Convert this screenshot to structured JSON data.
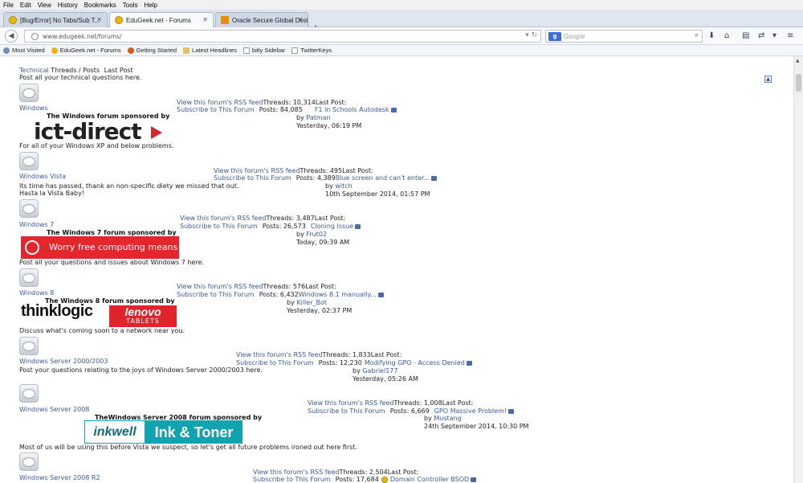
{
  "menu": [
    "File",
    "Edit",
    "View",
    "History",
    "Bookmarks",
    "Tools",
    "Help"
  ],
  "tabs": [
    {
      "label": "[Bug/Error] No Tabs/Sub T...",
      "icon": "edugeek-icon"
    },
    {
      "label": "EduGeek.net - Forums",
      "icon": "edugeek-icon"
    },
    {
      "label": "Oracle Secure Global Deskt...",
      "icon": "oracle-icon"
    }
  ],
  "address": {
    "url": "www.edugeek.net/forums/",
    "search_placeholder": "Google"
  },
  "bookmarks": [
    "Most Visited",
    "EduGeek.net - Forums",
    "Getting Started",
    "Latest Headlines",
    "bitly Sidebar",
    "TwitterKeys"
  ],
  "header": {
    "category": "Technical",
    "columns": "Threads / Posts",
    "last_post": "Last Post",
    "description": "Post all your technical questions here."
  },
  "rss_label": "View this forum's RSS feed",
  "subscribe_label": "Subscribe to This Forum",
  "by_label": "by",
  "forums": [
    {
      "name": "Windows",
      "threads": "Threads: 10,314",
      "posts": "Posts: 84,085",
      "last_post_label": "Last Post:",
      "last_title": "F1 in Schools Autodesk",
      "last_user": "Patman",
      "last_time": "Yesterday, 06:19 PM",
      "sponsor": "The Windows forum sponsored by",
      "sponsor_logo": "ict-direct",
      "desc": "For all of your Windows XP and below problems."
    },
    {
      "name": "Windows Vista",
      "threads": "Threads: 495",
      "posts": "Posts: 4,389",
      "last_post_label": "Last Post:",
      "last_title": "Blue screen and can't enter...",
      "last_user": "witch",
      "last_time": "10th September 2014, 01:57 PM",
      "desc": "Its time has passed, thank an non-specific diety we missed that out.",
      "desc2": "Hasta la Vista Baby!"
    },
    {
      "name": "Windows 7",
      "threads": "Threads: 3,487",
      "posts": "Posts: 26,573",
      "last_post_label": "Last Post:",
      "last_title": "Cloning Issue",
      "last_user": "Frut02",
      "last_time": "Today, 09:39 AM",
      "sponsor": "The Windows 7 forum sponsored by",
      "banner_text": "Worry free computing means",
      "banner_logo": "novatech",
      "desc": "Post all your questions and issues about Windows 7 here."
    },
    {
      "name": "Windows 8",
      "threads": "Threads: 576",
      "posts": "Posts: 6,432",
      "last_post_label": "Last Post:",
      "last_title": "Windows 8.1 manually...",
      "last_user": "Killer_Bot",
      "last_time": "Yesterday, 02:37 PM",
      "sponsor": "The Windows 8 forum sponsored by",
      "logo_left": "thinklogic",
      "logo_right": "lenovo",
      "logo_right_sub": "TABLETS",
      "desc": "Discuss what's coming soon to a network near you."
    },
    {
      "name": "Windows Server 2000/2003",
      "threads": "Threads: 1,833",
      "posts": "Posts: 12,230",
      "last_post_label": "Last Post:",
      "last_title": "Modifying GPO - Access Denied",
      "last_user": "Gabriel177",
      "last_time": "Yesterday, 05:26 AM",
      "desc": "Post your questions relating to the joys of Windows Server 2000/2003 here."
    },
    {
      "name": "Windows Server 2008",
      "threads": "Threads: 1,008",
      "posts": "Posts: 6,669",
      "last_post_label": "Last Post:",
      "last_title": "GPO Massive Problem!",
      "last_user": "Mustang",
      "last_time": "24th September 2014, 10:30 PM",
      "sponsor": "TheWindows Server 2008 forum sponsored by",
      "logo_left": "inkwell",
      "logo_right": "Ink & Toner",
      "desc": "Most of us will be using this before Vista we suspect, so let's get all future problems ironed out here first."
    },
    {
      "name": "Windows Server 2008 R2",
      "threads": "Threads: 2,504",
      "posts": "Posts: 17,684",
      "last_post_label": "Last Post:",
      "last_title": "Domain Controller BSOD"
    }
  ],
  "colors": {
    "link": "#3b5a9a",
    "ict_red": "#d5262c",
    "novatech_red": "#e3262b",
    "lenovo_red": "#e1232b",
    "inkwell_teal": "#12a3b0"
  }
}
